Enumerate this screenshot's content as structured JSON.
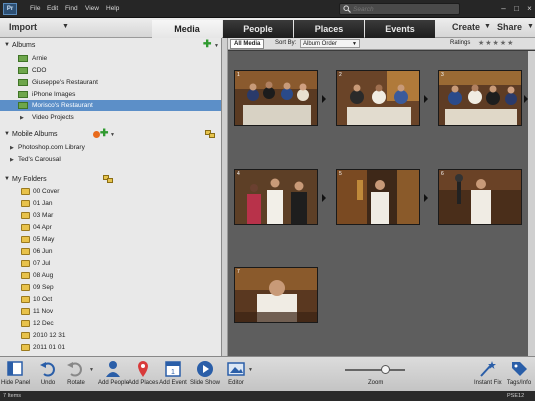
{
  "menu": {
    "app_icon": "Pr",
    "items": [
      "File",
      "Edit",
      "Find",
      "View",
      "Help"
    ],
    "search_placeholder": "Search"
  },
  "toolbar": {
    "import_label": "Import",
    "tabs": [
      {
        "label": "Media",
        "active": true
      },
      {
        "label": "People",
        "active": false
      },
      {
        "label": "Places",
        "active": false
      },
      {
        "label": "Events",
        "active": false
      }
    ],
    "create_label": "Create",
    "share_label": "Share"
  },
  "sidebar": {
    "albums_header": "Albums",
    "albums": [
      {
        "label": "Arnie",
        "selected": false
      },
      {
        "label": "CDO",
        "selected": false
      },
      {
        "label": "Giuseppe's Restaurant",
        "selected": false
      },
      {
        "label": "iPhone Images",
        "selected": false
      },
      {
        "label": "Morisco's Restaurant",
        "selected": true
      }
    ],
    "album_group": "Video Projects",
    "mobile_header": "Mobile Albums",
    "mobile_items": [
      "Photoshop.com Library",
      "Ted's Carousal"
    ],
    "folders_header": "My Folders",
    "folders": [
      "00 Cover",
      "01 Jan",
      "03 Mar",
      "04 Apr",
      "05 May",
      "06 Jun",
      "07 Jul",
      "08 Aug",
      "09 Sep",
      "10 Oct",
      "11 Nov",
      "12 Dec",
      "2010 12 31",
      "2011 01 01"
    ]
  },
  "media": {
    "all_media_label": "All Media",
    "sort_by_label": "Sort By:",
    "sort_value": "Album Order",
    "ratings_label": "Ratings",
    "ratings_stars": "★★★★★",
    "thumbnails": [
      {
        "num": "1",
        "stacked": true
      },
      {
        "num": "2",
        "stacked": true
      },
      {
        "num": "3",
        "stacked": true
      },
      {
        "num": "4",
        "stacked": true
      },
      {
        "num": "5",
        "stacked": true
      },
      {
        "num": "6",
        "stacked": false
      },
      {
        "num": "7",
        "stacked": false
      }
    ]
  },
  "bottombar": {
    "hide_panel": "Hide Panel",
    "undo": "Undo",
    "rotate": "Rotate",
    "add_people": "Add People",
    "add_places": "Add Places",
    "add_event": "Add Event",
    "slide_show": "Slide Show",
    "editor": "Editor",
    "zoom": "Zoom",
    "instant_fix": "Instant Fix",
    "tags_info": "Tags/Info"
  },
  "status": {
    "items": "7 Items",
    "app": "PSE12"
  },
  "colors": {
    "selection": "#5c8fc8",
    "album_green": "#6ea64b",
    "folder_yellow": "#e8c24a",
    "grid_bg": "#5e5e5e"
  }
}
